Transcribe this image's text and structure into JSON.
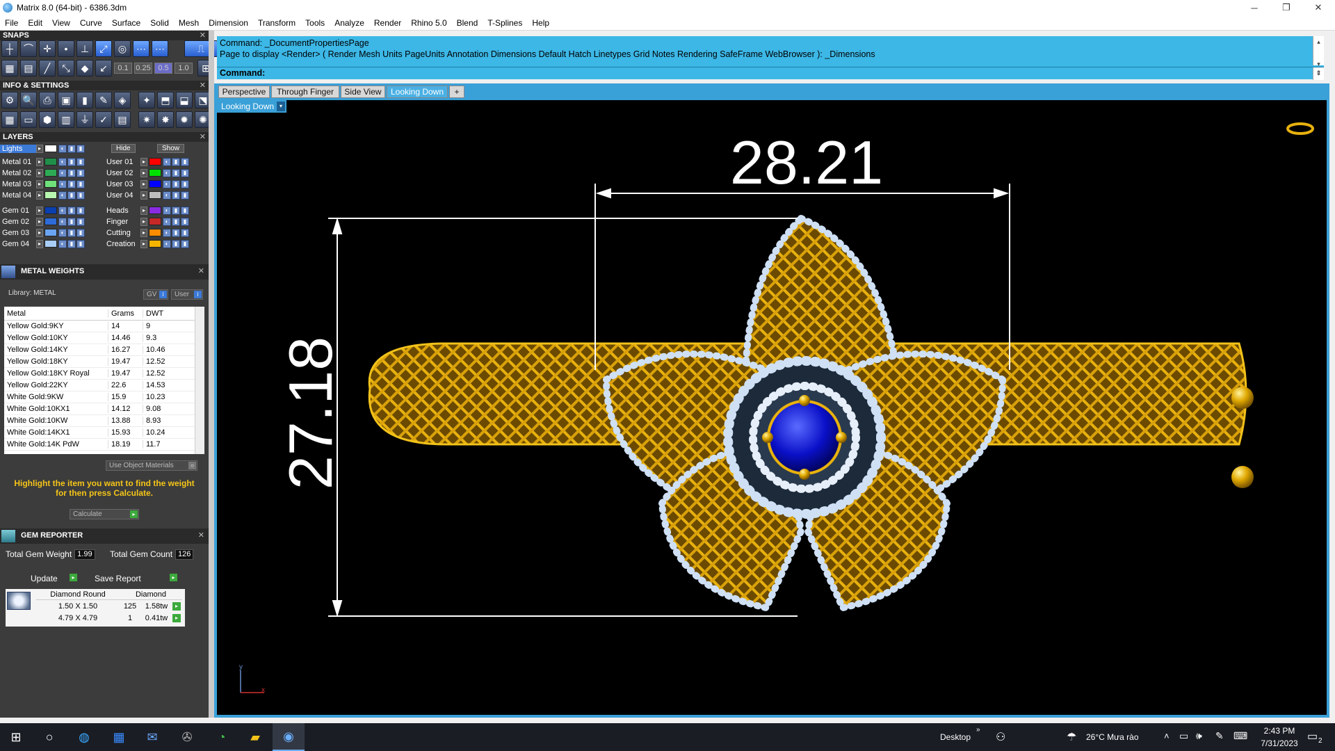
{
  "window": {
    "title": "Matrix 8.0 (64-bit) - 6386.3dm",
    "minimize": "─",
    "restore": "❐",
    "close": "✕"
  },
  "menu": [
    "File",
    "Edit",
    "View",
    "Curve",
    "Surface",
    "Solid",
    "Mesh",
    "Dimension",
    "Transform",
    "Tools",
    "Analyze",
    "Render",
    "Rhino 5.0",
    "Blend",
    "T-Splines",
    "Help"
  ],
  "panels": {
    "snaps": "SNAPS",
    "snap_values": [
      "0.1",
      "0.25",
      "0.5",
      "1.0"
    ],
    "info": "INFO & SETTINGS",
    "layers": "LAYERS",
    "layers_top": {
      "lights": "Lights",
      "hide": "Hide",
      "show": "Show"
    },
    "layers_left": [
      {
        "name": "Metal 01",
        "color": "#1f8f4a"
      },
      {
        "name": "Metal 02",
        "color": "#2eaa55"
      },
      {
        "name": "Metal 03",
        "color": "#6fe07a"
      },
      {
        "name": "Metal 04",
        "color": "#b8f5b0"
      },
      {
        "name": "Gem 01",
        "color": "#0a3fb0"
      },
      {
        "name": "Gem 02",
        "color": "#2d6bd8"
      },
      {
        "name": "Gem 03",
        "color": "#6aa4f0"
      },
      {
        "name": "Gem 04",
        "color": "#a8cdf7"
      }
    ],
    "layers_right": [
      {
        "name": "User 01",
        "color": "#ff0000"
      },
      {
        "name": "User 02",
        "color": "#00e000"
      },
      {
        "name": "User 03",
        "color": "#0000ff"
      },
      {
        "name": "User 04",
        "color": "#bdbdbd"
      },
      {
        "name": "Heads",
        "color": "#8a2be2"
      },
      {
        "name": "Finger",
        "color": "#c62828"
      },
      {
        "name": "Cutting",
        "color": "#ff8c00"
      },
      {
        "name": "Creation",
        "color": "#f4b400"
      }
    ],
    "metal_weights": {
      "title": "METAL WEIGHTS",
      "library": "Library: METAL",
      "gv": "GV",
      "user": "User",
      "columns": [
        "Metal",
        "Grams",
        "DWT"
      ],
      "rows": [
        [
          "Yellow Gold:9KY",
          "14",
          "9"
        ],
        [
          "Yellow Gold:10KY",
          "14.46",
          "9.3"
        ],
        [
          "Yellow Gold:14KY",
          "16.27",
          "10.46"
        ],
        [
          "Yellow Gold:18KY",
          "19.47",
          "12.52"
        ],
        [
          "Yellow Gold:18KY Royal",
          "19.47",
          "12.52"
        ],
        [
          "Yellow Gold:22KY",
          "22.6",
          "14.53"
        ],
        [
          "White Gold:9KW",
          "15.9",
          "10.23"
        ],
        [
          "White Gold:10KX1",
          "14.12",
          "9.08"
        ],
        [
          "White Gold:10KW",
          "13.88",
          "8.93"
        ],
        [
          "White Gold:14KX1",
          "15.93",
          "10.24"
        ],
        [
          "White Gold:14K PdW",
          "18.19",
          "11.7"
        ]
      ],
      "use_object": "Use Object Materials",
      "hint": "Highlight the item you want to find the weight for then press Calculate.",
      "calculate": "Calculate"
    },
    "gem_reporter": {
      "title": "GEM REPORTER",
      "total_weight_label": "Total Gem Weight",
      "total_weight": "1.99",
      "total_count_label": "Total Gem Count",
      "total_count": "126",
      "update": "Update",
      "save": "Save Report",
      "header": [
        "Diamond Round",
        "Diamond"
      ],
      "rows": [
        [
          "1.50 X 1.50",
          "125",
          "1.58tw"
        ],
        [
          "4.79 X 4.79",
          "1",
          "0.41tw"
        ]
      ]
    }
  },
  "command": {
    "line1": "Command: _DocumentPropertiesPage",
    "line2": "Page to display <Render> ( Render  Mesh  Units  PageUnits  Annotation  Dimensions  Default  Hatch  Linetypes  Grid  Notes  Rendering  SafeFrame  WebBrowser ): _Dimensions",
    "prompt": "Command:"
  },
  "viewtabs": [
    "Perspective",
    "Through Finger",
    "Side View",
    "Looking Down",
    "+"
  ],
  "viewport": {
    "label": "Looking Down",
    "dim_width": "28.21",
    "dim_height": "27.18",
    "axis_x": "x",
    "axis_y": "y"
  },
  "taskbar": {
    "desktop": "Desktop",
    "weather": "26°C  Mưa rào",
    "time": "2:43 PM",
    "date": "7/31/2023",
    "notif": "2"
  }
}
